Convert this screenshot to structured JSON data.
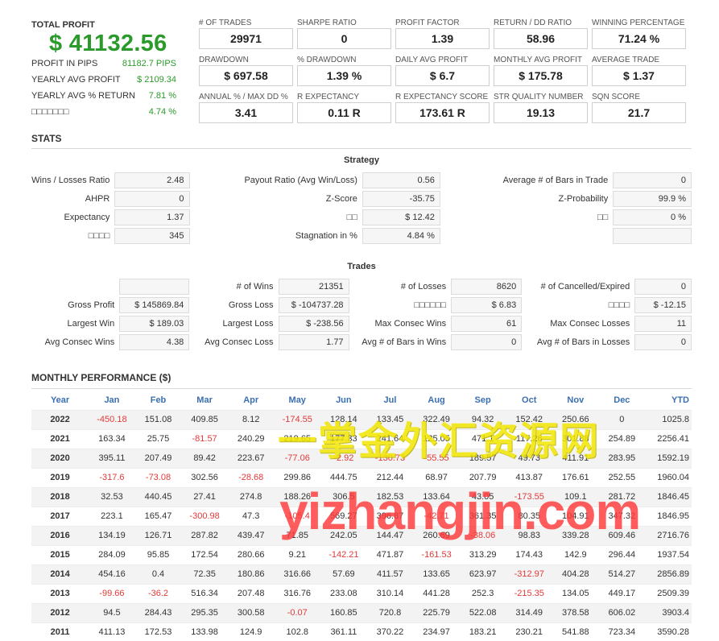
{
  "summary": {
    "total_label": "TOTAL PROFIT",
    "total_value": "$ 41132.56",
    "rows": [
      {
        "label": "PROFIT IN PIPS",
        "value": "81182.7 PIPS"
      },
      {
        "label": "YEARLY AVG PROFIT",
        "value": "$ 2109.34"
      },
      {
        "label": "YEARLY AVG % RETURN",
        "value": "7.81 %"
      },
      {
        "label": "□□□□□□□",
        "value": "4.74 %"
      }
    ]
  },
  "metrics": [
    {
      "label": "# OF TRADES",
      "value": "29971"
    },
    {
      "label": "SHARPE RATIO",
      "value": "0"
    },
    {
      "label": "PROFIT FACTOR",
      "value": "1.39"
    },
    {
      "label": "RETURN / DD RATIO",
      "value": "58.96"
    },
    {
      "label": "WINNING PERCENTAGE",
      "value": "71.24 %"
    },
    {
      "label": "DRAWDOWN",
      "value": "$ 697.58"
    },
    {
      "label": "% DRAWDOWN",
      "value": "1.39 %"
    },
    {
      "label": "DAILY AVG PROFIT",
      "value": "$ 6.7"
    },
    {
      "label": "MONTHLY AVG PROFIT",
      "value": "$ 175.78"
    },
    {
      "label": "AVERAGE TRADE",
      "value": "$ 1.37"
    },
    {
      "label": "ANNUAL % / MAX DD %",
      "value": "3.41"
    },
    {
      "label": "R EXPECTANCY",
      "value": "0.11 R"
    },
    {
      "label": "R EXPECTANCY SCORE",
      "value": "173.61 R"
    },
    {
      "label": "STR QUALITY NUMBER",
      "value": "19.13"
    },
    {
      "label": "SQN SCORE",
      "value": "21.7"
    }
  ],
  "stats": {
    "title": "STATS",
    "strategy_title": "Strategy",
    "strategy": [
      [
        {
          "l": "Wins / Losses Ratio",
          "v": "2.48"
        },
        {
          "l": "Payout Ratio (Avg Win/Loss)",
          "v": "0.56"
        },
        {
          "l": "Average # of Bars in Trade",
          "v": "0"
        }
      ],
      [
        {
          "l": "AHPR",
          "v": "0"
        },
        {
          "l": "Z-Score",
          "v": "-35.75"
        },
        {
          "l": "Z-Probability",
          "v": "99.9 %"
        }
      ],
      [
        {
          "l": "Expectancy",
          "v": "1.37"
        },
        {
          "l": "□□",
          "v": "$ 12.42"
        },
        {
          "l": "□□",
          "v": "0 %"
        }
      ],
      [
        {
          "l": "□□□□",
          "v": "345"
        },
        {
          "l": "Stagnation in %",
          "v": "4.84 %"
        },
        {
          "l": "",
          "v": ""
        }
      ]
    ],
    "trades_title": "Trades",
    "trades": [
      [
        {
          "l": "",
          "v": ""
        },
        {
          "l": "# of Wins",
          "v": "21351"
        },
        {
          "l": "# of Losses",
          "v": "8620"
        },
        {
          "l": "# of Cancelled/Expired",
          "v": "0"
        }
      ],
      [
        {
          "l": "Gross Profit",
          "v": "$ 145869.84"
        },
        {
          "l": "Gross Loss",
          "v": "$ -104737.28"
        },
        {
          "l": "□□□□□□",
          "v": "$ 6.83"
        },
        {
          "l": "□□□□",
          "v": "$ -12.15"
        }
      ],
      [
        {
          "l": "Largest Win",
          "v": "$ 189.03"
        },
        {
          "l": "Largest Loss",
          "v": "$ -238.56"
        },
        {
          "l": "Max Consec Wins",
          "v": "61"
        },
        {
          "l": "Max Consec Losses",
          "v": "11"
        }
      ],
      [
        {
          "l": "Avg Consec Wins",
          "v": "4.38"
        },
        {
          "l": "Avg Consec Loss",
          "v": "1.77"
        },
        {
          "l": "Avg # of Bars in Wins",
          "v": "0"
        },
        {
          "l": "Avg # of Bars in Losses",
          "v": "0"
        }
      ]
    ]
  },
  "monthly": {
    "title": "MONTHLY PERFORMANCE ($)",
    "headers": [
      "Year",
      "Jan",
      "Feb",
      "Mar",
      "Apr",
      "May",
      "Jun",
      "Jul",
      "Aug",
      "Sep",
      "Oct",
      "Nov",
      "Dec",
      "YTD"
    ],
    "rows": [
      [
        "2022",
        "-450.18",
        "151.08",
        "409.85",
        "8.12",
        "-174.55",
        "128.14",
        "133.45",
        "322.49",
        "94.32",
        "152.42",
        "250.66",
        "0",
        "1025.8"
      ],
      [
        "2021",
        "163.34",
        "25.75",
        "-81.57",
        "240.29",
        "219.65",
        "177.33",
        "241.64",
        "125.05",
        "471.1",
        "117.26",
        "301.88",
        "254.89",
        "2256.41"
      ],
      [
        "2020",
        "395.11",
        "207.49",
        "89.42",
        "223.67",
        "-77.06",
        "-2.92",
        "-130.73",
        "-55.55",
        "189.57",
        "49.73",
        "411.91",
        "283.95",
        "1592.19"
      ],
      [
        "2019",
        "-317.6",
        "-73.08",
        "302.56",
        "-28.68",
        "299.86",
        "444.75",
        "212.44",
        "68.97",
        "207.79",
        "413.87",
        "176.61",
        "252.55",
        "1960.04"
      ],
      [
        "2018",
        "32.53",
        "440.45",
        "27.41",
        "274.8",
        "188.26",
        "306.5",
        "182.53",
        "133.64",
        "43.05",
        "-173.55",
        "109.1",
        "281.72",
        "1846.45"
      ],
      [
        "2017",
        "223.1",
        "165.47",
        "-300.98",
        "47.3",
        "-105.4",
        "569.27",
        "396.87",
        "-42.71",
        "361.35",
        "80.35",
        "104.91",
        "347.32",
        "1846.95"
      ],
      [
        "2016",
        "134.19",
        "126.71",
        "287.82",
        "439.47",
        "71.85",
        "242.05",
        "144.47",
        "260.69",
        "-38.06",
        "98.83",
        "339.28",
        "609.46",
        "2716.76"
      ],
      [
        "2015",
        "284.09",
        "95.85",
        "172.54",
        "280.66",
        "9.21",
        "-142.21",
        "471.87",
        "-161.53",
        "313.29",
        "174.43",
        "142.9",
        "296.44",
        "1937.54"
      ],
      [
        "2014",
        "454.16",
        "0.4",
        "72.35",
        "180.86",
        "316.66",
        "57.69",
        "411.57",
        "133.65",
        "623.97",
        "-312.97",
        "404.28",
        "514.27",
        "2856.89"
      ],
      [
        "2013",
        "-99.66",
        "-36.2",
        "516.34",
        "207.48",
        "316.76",
        "233.08",
        "310.14",
        "441.28",
        "252.3",
        "-215.35",
        "134.05",
        "449.17",
        "2509.39"
      ],
      [
        "2012",
        "94.5",
        "284.43",
        "295.35",
        "300.58",
        "-0.07",
        "160.85",
        "720.8",
        "225.79",
        "522.08",
        "314.49",
        "378.58",
        "606.02",
        "3903.4"
      ],
      [
        "2011",
        "411.13",
        "172.53",
        "133.98",
        "124.9",
        "102.8",
        "361.11",
        "370.22",
        "234.97",
        "183.21",
        "230.21",
        "541.88",
        "723.34",
        "3590.28"
      ]
    ]
  },
  "watermark": {
    "line1": "一掌金外汇资源网",
    "line2": "yizhangjin.com"
  }
}
